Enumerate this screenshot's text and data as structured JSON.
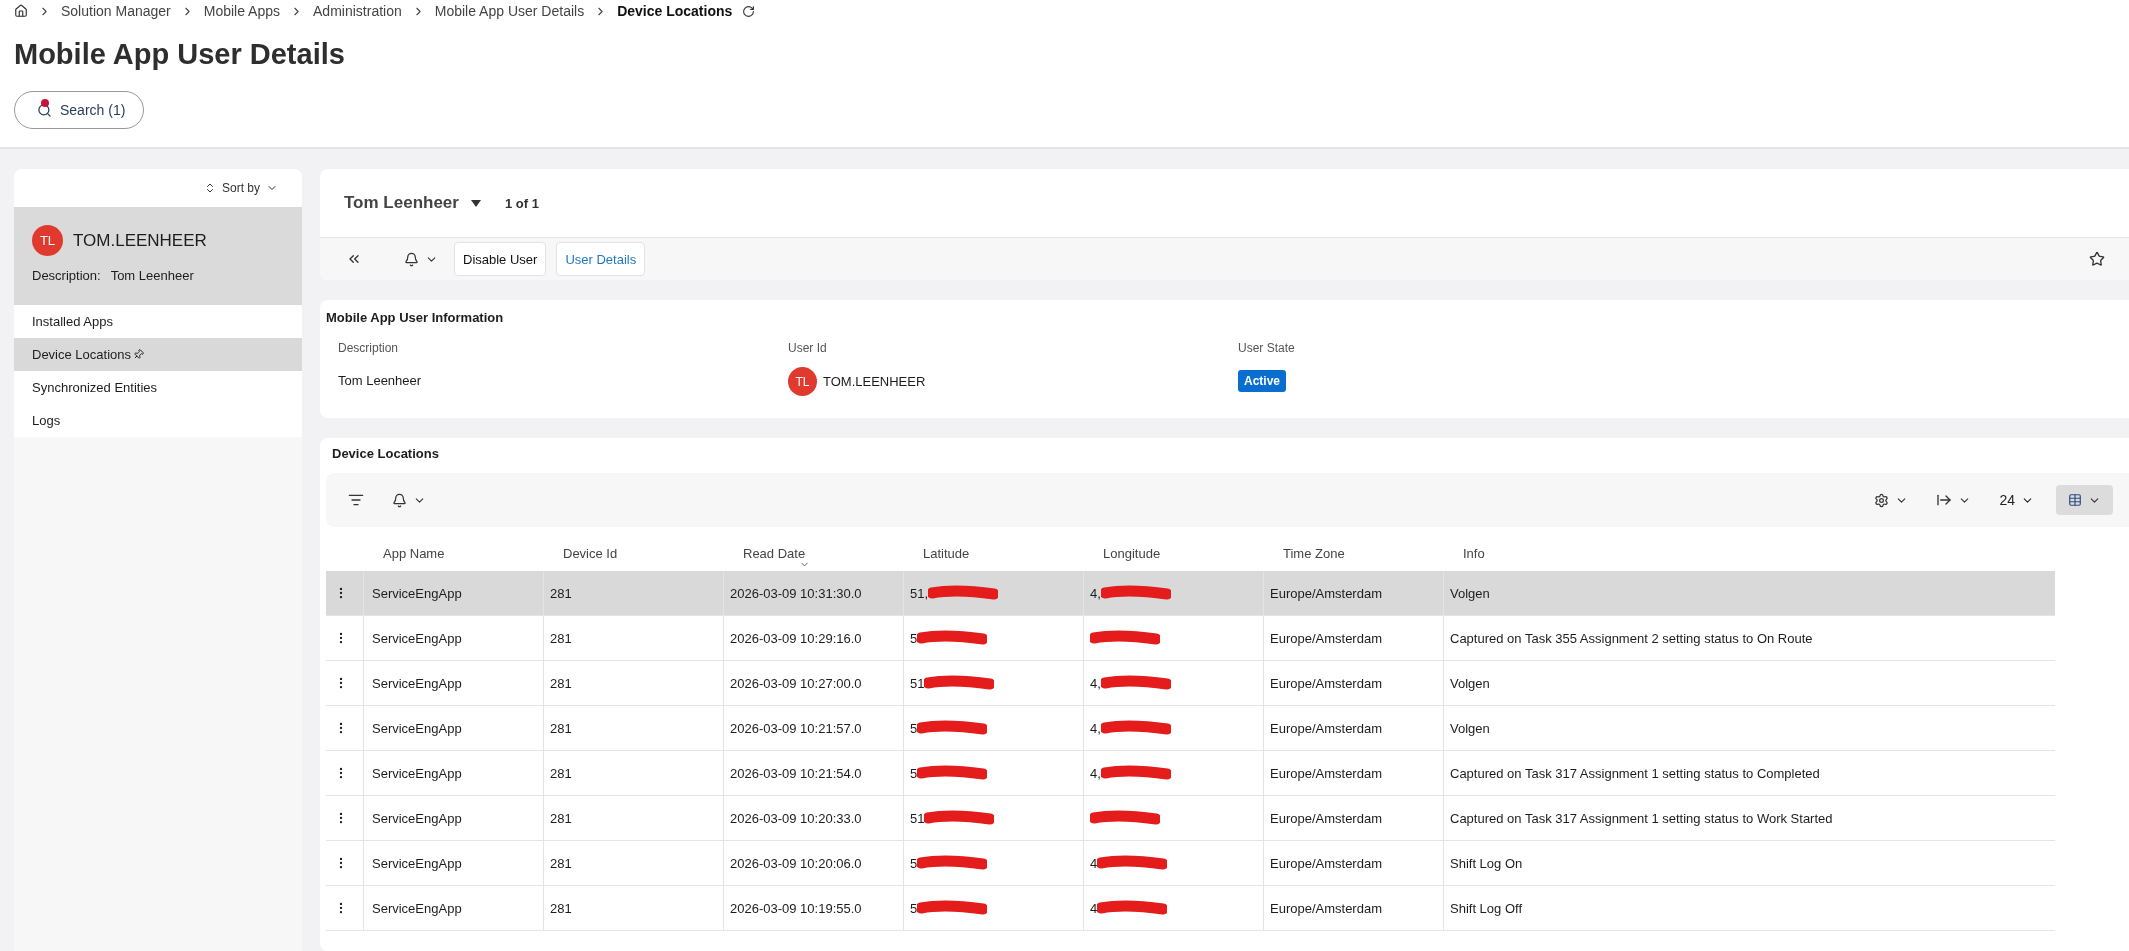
{
  "breadcrumbs": [
    {
      "label": "Solution Manager",
      "current": false
    },
    {
      "label": "Mobile Apps",
      "current": false
    },
    {
      "label": "Administration",
      "current": false
    },
    {
      "label": "Mobile App User Details",
      "current": false
    },
    {
      "label": "Device Locations",
      "current": true
    }
  ],
  "page_title": "Mobile App User Details",
  "search_button": {
    "label": "Search (1)",
    "has_filters": true
  },
  "sidebar": {
    "sort_label": "Sort by",
    "user": {
      "initials": "TL",
      "name": "TOM.LEENHEER",
      "description_label": "Description:",
      "description": "Tom Leenheer"
    },
    "items": [
      {
        "label": "Installed Apps",
        "selected": false,
        "pinned": false
      },
      {
        "label": "Device Locations",
        "selected": true,
        "pinned": true
      },
      {
        "label": "Synchronized Entities",
        "selected": false,
        "pinned": false
      },
      {
        "label": "Logs",
        "selected": false,
        "pinned": false
      }
    ]
  },
  "record_header": {
    "name": "Tom Leenheer",
    "counter": "1 of 1",
    "actions": [
      {
        "label": "Disable User",
        "kind": "plain"
      },
      {
        "label": "User Details",
        "kind": "link"
      }
    ]
  },
  "info_section": {
    "title": "Mobile App User Information",
    "fields": [
      {
        "label": "Description",
        "value": "Tom Leenheer",
        "kind": "text"
      },
      {
        "label": "User Id",
        "value": "TOM.LEENHEER",
        "initials": "TL",
        "kind": "user"
      },
      {
        "label": "User State",
        "value": "Active",
        "kind": "badge"
      }
    ]
  },
  "device_locations": {
    "title": "Device Locations",
    "page_size": "24",
    "columns": [
      {
        "label": "App Name",
        "sorted": false
      },
      {
        "label": "Device Id",
        "sorted": false
      },
      {
        "label": "Read Date",
        "sorted": true
      },
      {
        "label": "Latitude",
        "sorted": false
      },
      {
        "label": "Longitude",
        "sorted": false
      },
      {
        "label": "Time Zone",
        "sorted": false
      },
      {
        "label": "Info",
        "sorted": false
      }
    ],
    "rows": [
      {
        "selected": true,
        "app_name": "ServiceEngApp",
        "device_id": "281",
        "read_date": "2026-03-09 10:31:30.0",
        "latitude": "51,",
        "longitude": "4,",
        "time_zone": "Europe/Amsterdam",
        "info": "Volgen"
      },
      {
        "selected": false,
        "app_name": "ServiceEngApp",
        "device_id": "281",
        "read_date": "2026-03-09 10:29:16.0",
        "latitude": "5",
        "time_zone": "Europe/Amsterdam",
        "info": "Captured on Task 355 Assignment 2 setting status to On Route"
      },
      {
        "selected": false,
        "app_name": "ServiceEngApp",
        "device_id": "281",
        "read_date": "2026-03-09 10:27:00.0",
        "latitude": "51",
        "longitude": "4,",
        "time_zone": "Europe/Amsterdam",
        "info": "Volgen"
      },
      {
        "selected": false,
        "app_name": "ServiceEngApp",
        "device_id": "281",
        "read_date": "2026-03-09 10:21:57.0",
        "latitude": "5",
        "longitude": "4,",
        "time_zone": "Europe/Amsterdam",
        "info": "Volgen"
      },
      {
        "selected": false,
        "app_name": "ServiceEngApp",
        "device_id": "281",
        "read_date": "2026-03-09 10:21:54.0",
        "latitude": "5",
        "longitude": "4,",
        "time_zone": "Europe/Amsterdam",
        "info": "Captured on Task 317 Assignment 1 setting status to Completed"
      },
      {
        "selected": false,
        "app_name": "ServiceEngApp",
        "device_id": "281",
        "read_date": "2026-03-09 10:20:33.0",
        "latitude": "51",
        "time_zone": "Europe/Amsterdam",
        "info": "Captured on Task 317 Assignment 1 setting status to Work Started"
      },
      {
        "selected": false,
        "app_name": "ServiceEngApp",
        "device_id": "281",
        "read_date": "2026-03-09 10:20:06.0",
        "latitude": "5",
        "longitude": "4",
        "time_zone": "Europe/Amsterdam",
        "info": "Shift Log On"
      },
      {
        "selected": false,
        "app_name": "ServiceEngApp",
        "device_id": "281",
        "read_date": "2026-03-09 10:19:55.0",
        "latitude": "5",
        "longitude": "4",
        "time_zone": "Europe/Amsterdam",
        "info": "Shift Log Off"
      }
    ]
  }
}
